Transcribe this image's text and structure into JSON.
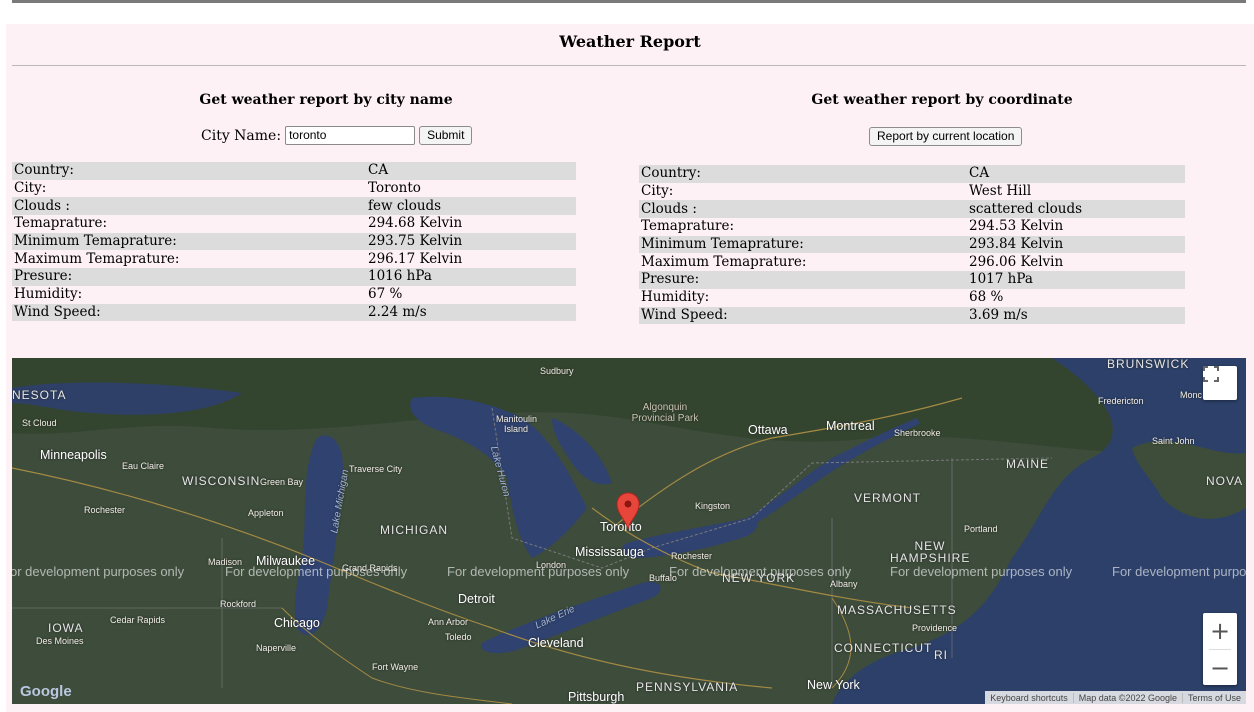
{
  "page": {
    "title": "Weather Report"
  },
  "city_section": {
    "heading": "Get weather report by city name",
    "label": "City Name:",
    "input_value": "toronto",
    "submit_label": "Submit",
    "rows": [
      {
        "label": "Country:",
        "value": "CA"
      },
      {
        "label": "City:",
        "value": "Toronto"
      },
      {
        "label": "Clouds :",
        "value": "few clouds"
      },
      {
        "label": "Temaprature:",
        "value": "294.68 Kelvin"
      },
      {
        "label": "Minimum Temaprature:",
        "value": "293.75 Kelvin"
      },
      {
        "label": "Maximum Temaprature:",
        "value": "296.17 Kelvin"
      },
      {
        "label": "Presure:",
        "value": "1016 hPa"
      },
      {
        "label": "Humidity:",
        "value": "67 %"
      },
      {
        "label": "Wind Speed:",
        "value": "2.24 m/s"
      }
    ]
  },
  "coord_section": {
    "heading": "Get weather report by coordinate",
    "button_label": "Report by current location",
    "rows": [
      {
        "label": "Country:",
        "value": "CA"
      },
      {
        "label": "City:",
        "value": "West Hill"
      },
      {
        "label": "Clouds :",
        "value": "scattered clouds"
      },
      {
        "label": "Temaprature:",
        "value": "294.53 Kelvin"
      },
      {
        "label": "Minimum Temaprature:",
        "value": "293.84 Kelvin"
      },
      {
        "label": "Maximum Temaprature:",
        "value": "296.06 Kelvin"
      },
      {
        "label": "Presure:",
        "value": "1017 hPa"
      },
      {
        "label": "Humidity:",
        "value": "68 %"
      },
      {
        "label": "Wind Speed:",
        "value": "3.69 m/s"
      }
    ]
  },
  "map": {
    "watermark": "For development purposes only",
    "watermark_partial_left": "or development purposes only",
    "watermark_partial_right": "For development purpo",
    "google_logo": "Google",
    "keyboard_shortcuts": "Keyboard shortcuts",
    "map_data": "Map data ©2022 Google",
    "terms": "Terms of Use",
    "zoom_in": "+",
    "zoom_out": "−",
    "labels": {
      "brunswick": "BRUNSWICK",
      "nesota": "NESOTA",
      "st_cloud": "St Cloud",
      "minneapolis": "Minneapolis",
      "eau_claire": "Eau Claire",
      "wisconsin": "WISCONSIN",
      "green_bay": "Green Bay",
      "appleton": "Appleton",
      "rochester_mn": "Rochester",
      "madison": "Madison",
      "milwaukee": "Milwaukee",
      "rockford": "Rockford",
      "iowa": "IOWA",
      "cedar_rapids": "Cedar Rapids",
      "des_moines": "Des Moines",
      "chicago": "Chicago",
      "naperville": "Naperville",
      "michigan": "MICHIGAN",
      "traverse_city": "Traverse City",
      "lake_michigan": "Lake Michigan",
      "grand_rapids": "Grand Rapids",
      "detroit": "Detroit",
      "ann_arbor": "Ann Arbor",
      "toledo": "Toledo",
      "fort_wayne": "Fort Wayne",
      "cleveland": "Cleveland",
      "lake_erie": "Lake Erie",
      "pittsburgh": "Pittsburgh",
      "pennsylvania": "PENNSYLVANIA",
      "sudbury": "Sudbury",
      "manitoulin": "Manitoulin Island",
      "lake_huron": "Lake Huron",
      "algonquin": "Algonquin Provincial Park",
      "ottawa": "Ottawa",
      "montreal": "Montreal",
      "sherbrooke": "Sherbrooke",
      "kingston": "Kingston",
      "toronto": "Toronto",
      "mississauga": "Mississauga",
      "london": "London",
      "rochester_ny": "Rochester",
      "buffalo": "Buffalo",
      "new_york_state": "NEW YORK",
      "albany": "Albany",
      "vermont": "VERMONT",
      "new_hampshire": "NEW HAMPSHIRE",
      "maine": "MAINE",
      "portland": "Portland",
      "massachusetts": "MASSACHUSETTS",
      "providence": "Providence",
      "connecticut": "CONNECTICUT",
      "ri": "RI",
      "new_york_city": "New York",
      "fredericton": "Fredericton",
      "moncton": "Monc",
      "saint_john": "Saint John",
      "nova": "NOVA"
    }
  }
}
